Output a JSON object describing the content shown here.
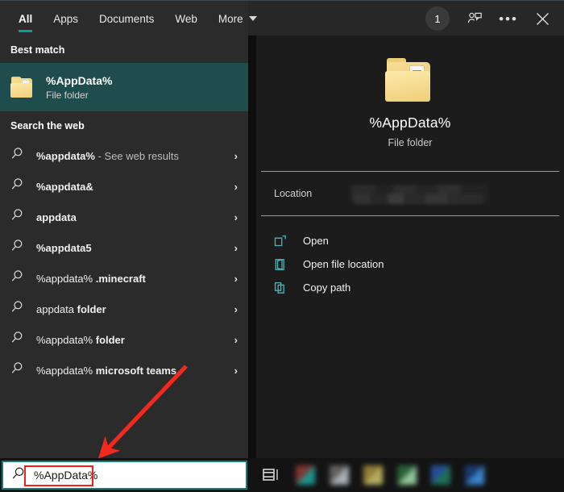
{
  "window": {
    "title": "Windows Search",
    "accent_teal": "#00a0a0",
    "selection_bg": "#1f4d4d",
    "annotation_red": "#f41f15"
  },
  "topbar": {
    "tabs": [
      {
        "label": "All",
        "active": true
      },
      {
        "label": "Apps",
        "active": false
      },
      {
        "label": "Documents",
        "active": false
      },
      {
        "label": "Web",
        "active": false
      },
      {
        "label": "More",
        "active": false,
        "has_caret": true
      }
    ],
    "badge_count": "1",
    "feedback_icon": "person-feedback-icon",
    "more_icon": "ellipsis-icon",
    "close_icon": "close-icon"
  },
  "left_pane": {
    "best_match_header": "Best match",
    "best_match": {
      "title": "%AppData%",
      "subtitle": "File folder",
      "icon": "folder-icon"
    },
    "web_header": "Search the web",
    "web_items": [
      {
        "prefix": "%appdata%",
        "prefix_bold": true,
        "suffix": " - See web results",
        "suffix_style": "dim"
      },
      {
        "prefix": "%appdata&",
        "prefix_bold": true,
        "suffix": "",
        "suffix_style": "none"
      },
      {
        "prefix": "appdata",
        "prefix_bold": true,
        "suffix": "",
        "suffix_style": "none"
      },
      {
        "prefix": "%appdata5",
        "prefix_bold": true,
        "suffix": "",
        "suffix_style": "none"
      },
      {
        "prefix": "%appdata% ",
        "prefix_bold": false,
        "suffix": ".minecraft",
        "suffix_style": "bold"
      },
      {
        "prefix": "appdata ",
        "prefix_bold": false,
        "suffix": "folder",
        "suffix_style": "bold"
      },
      {
        "prefix": "%appdata% ",
        "prefix_bold": false,
        "suffix": "folder",
        "suffix_style": "bold"
      },
      {
        "prefix": "%appdata% ",
        "prefix_bold": false,
        "suffix": "microsoft teams",
        "suffix_style": "bold"
      }
    ],
    "chevron": "›"
  },
  "right_pane": {
    "preview_title": "%AppData%",
    "preview_subtitle": "File folder",
    "preview_icon": "folder-icon",
    "location_label": "Location",
    "location_value_redacted": true,
    "actions": [
      {
        "label": "Open",
        "icon": "open-external-icon"
      },
      {
        "label": "Open file location",
        "icon": "open-folder-icon"
      },
      {
        "label": "Copy path",
        "icon": "copy-icon"
      }
    ]
  },
  "taskbar": {
    "search_value": "%AppData%",
    "search_placeholder": "Type here to search",
    "search_icon": "search-icon",
    "task_view_icon": "task-view-icon",
    "pinned_icons": [
      "app-icon-1",
      "app-icon-2",
      "app-icon-3",
      "app-icon-4",
      "app-icon-5",
      "app-icon-6"
    ]
  },
  "annotations": {
    "arrow": "red-arrow-annotation",
    "highlight_rect": "red-highlight-rectangle"
  }
}
